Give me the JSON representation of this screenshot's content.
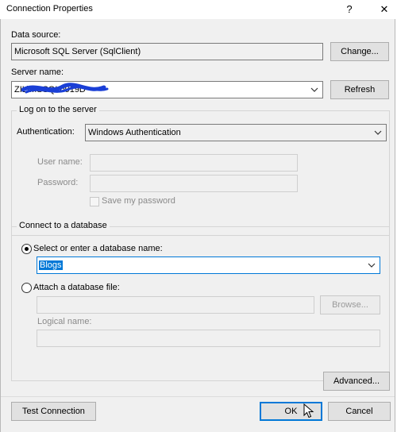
{
  "window": {
    "title": "Connection Properties",
    "help_glyph": "?",
    "close_glyph": "✕"
  },
  "data_source": {
    "label": "Data source:",
    "value": "Microsoft SQL Server (SqlClient)",
    "change_button": "Change..."
  },
  "server": {
    "label": "Server name:",
    "value": "ZIL\\MSSQL0919D",
    "refresh_button": "Refresh"
  },
  "logon": {
    "group_title": "Log on to the server",
    "auth_label": "Authentication:",
    "auth_value": "Windows Authentication",
    "username_label": "User name:",
    "username_value": "",
    "password_label": "Password:",
    "password_value": "",
    "save_password_label": "Save my password"
  },
  "database": {
    "group_title": "Connect to a database",
    "select_option_label": "Select or enter a database name:",
    "db_name_value": "Blogs",
    "attach_option_label": "Attach a database file:",
    "attach_file_value": "",
    "browse_button": "Browse...",
    "logical_name_label": "Logical name:",
    "logical_name_value": ""
  },
  "footer": {
    "advanced_button": "Advanced...",
    "test_button": "Test Connection",
    "ok_button": "OK",
    "cancel_button": "Cancel"
  },
  "colors": {
    "accent": "#0078d7",
    "redaction_scribble": "#1a3fd6"
  }
}
